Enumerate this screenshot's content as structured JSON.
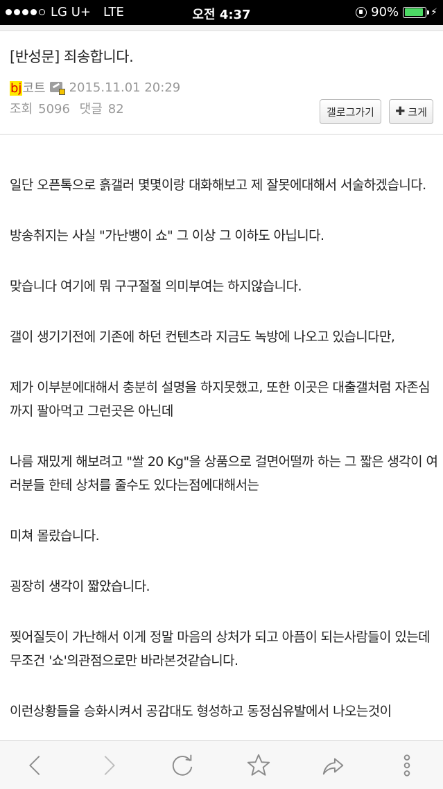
{
  "status_bar": {
    "carrier": "LG U+",
    "network": "LTE",
    "time": "오전 4:37",
    "battery_percent": "90%",
    "battery_level": 0.9,
    "signal_bars_filled": 4,
    "signal_bars_total": 5
  },
  "post": {
    "title": "[반성문] 죄송합니다.",
    "author_highlight": "bj",
    "author_rest": "코트",
    "author_badge_icon": "editor-badge-icon",
    "date": "2015.11.01 20:29",
    "views_label": "조회",
    "views": "5096",
    "comments_label": "댓글",
    "comments": "82"
  },
  "buttons": {
    "back_to_gallery": "갤로그가기",
    "enlarge": "크게"
  },
  "body_paragraphs": [
    "일단 오픈톡으로 흙갤러 몇몇이랑 대화해보고 제 잘못에대해서 서술하겠습니다.",
    "방송취지는 사실 \"가난뱅이 쇼\" 그 이상 그 이하도 아닙니다.",
    "맞습니다 여기에 뭐 구구절절 의미부여는 하지않습니다.",
    "갤이 생기기전에 기존에 하던 컨텐츠라 지금도 녹방에 나오고 있습니다만,",
    "제가 이부분에대해서 충분히 설명을 하지못했고, 또한 이곳은 대출갤처럼 자존심까지 팔아먹고 그런곳은 아닌데",
    "나름 재밌게 해보려고 \"쌀 20 Kg\"을 상품으로 걸면어떨까 하는 그 짧은 생각이 여러분들 한테 상처를 줄수도 있다는점에대해서는",
    "미쳐 몰랐습니다.",
    "굉장히 생각이 짧았습니다.",
    "찢어질듯이 가난해서 이게 정말 마음의 상처가 되고 아픔이 되는사람들이 있는데 무조건 '쇼'의관점으로만 바라본것같습니다.",
    "이런상황들을 승화시켜서 공감대도 형성하고 동정심유발에서 나오는것이"
  ],
  "toolbar": {
    "icons": [
      "back-icon",
      "forward-icon",
      "reload-icon",
      "bookmark-star-icon",
      "share-icon",
      "more-icon"
    ]
  },
  "colors": {
    "status_bar_bg": "#000000",
    "battery_green": "#4cd964",
    "author_highlight_bg": "#ffea00",
    "author_highlight_text": "#dd0000",
    "meta_gray": "#999999"
  }
}
